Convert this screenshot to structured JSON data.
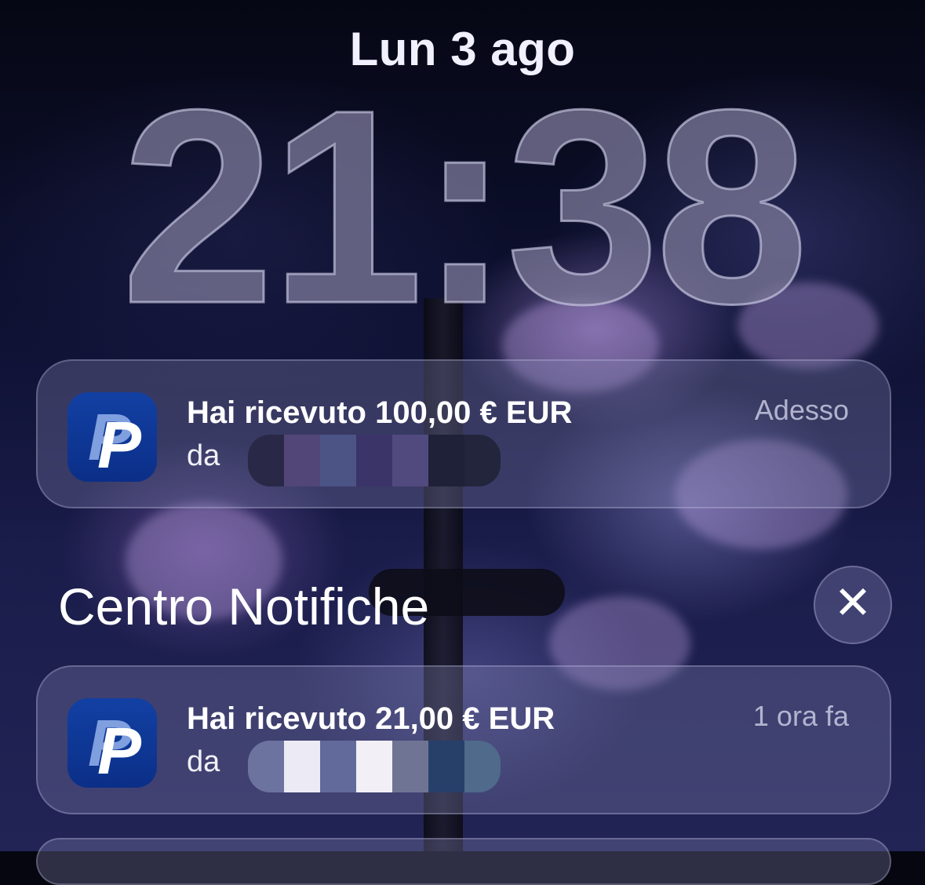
{
  "lockscreen": {
    "date": "Lun 3 ago",
    "time": "21:38"
  },
  "notifications": [
    {
      "app": "PayPal",
      "icon": "paypal-icon",
      "title": "Hai ricevuto 100,00 € EUR",
      "from_label": "da",
      "sender_redacted": true,
      "timestamp": "Adesso"
    },
    {
      "app": "PayPal",
      "icon": "paypal-icon",
      "title": "Hai ricevuto 21,00 € EUR",
      "from_label": "da",
      "sender_redacted": true,
      "timestamp": "1 ora fa"
    }
  ],
  "notification_center": {
    "title": "Centro Notifiche",
    "close_icon": "close-icon"
  },
  "colors": {
    "paypal_blue": "#0b2f88",
    "paypal_light": "#7f9fdf"
  }
}
